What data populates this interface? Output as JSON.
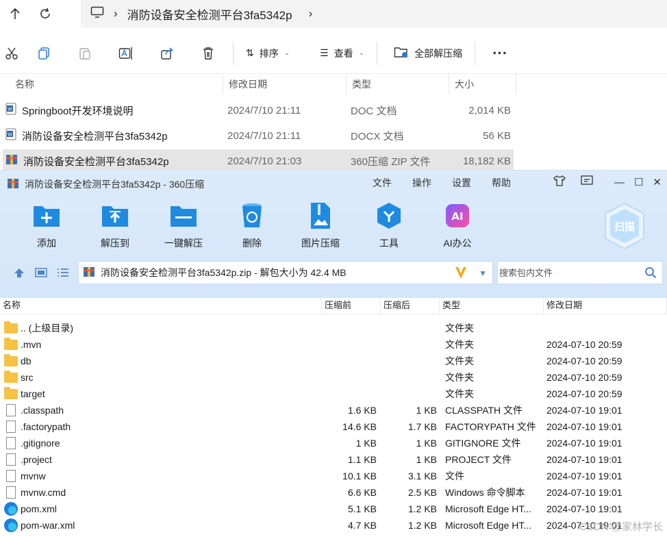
{
  "explorer": {
    "breadcrumb": "消防设备安全检测平台3fa5342p",
    "toolbar": {
      "sort_label": "排序",
      "view_label": "查看",
      "extract_all_label": "全部解压缩"
    },
    "columns": [
      "名称",
      "修改日期",
      "类型",
      "大小"
    ],
    "files": [
      {
        "name": "Springboot开发环境说明",
        "date": "2024/7/10 21:11",
        "type": "DOC 文档",
        "size": "2,014 KB"
      },
      {
        "name": "消防设备安全检测平台3fa5342p",
        "date": "2024/7/10 21:11",
        "type": "DOCX 文档",
        "size": "56 KB"
      },
      {
        "name": "消防设备安全检测平台3fa5342p",
        "date": "2024/7/10 21:03",
        "type": "360压缩 ZIP 文件",
        "size": "18,182 KB"
      }
    ]
  },
  "zip": {
    "title": "消防设备安全检测平台3fa5342p - 360压缩",
    "menu": [
      "文件",
      "操作",
      "设置",
      "帮助"
    ],
    "tools": [
      "添加",
      "解压到",
      "一键解压",
      "删除",
      "图片压缩",
      "工具",
      "AI办公"
    ],
    "scan_label": "扫描",
    "path": "消防设备安全检测平台3fa5342p.zip - 解包大小为 42.4 MB",
    "search_placeholder": "搜索包内文件",
    "columns": [
      "名称",
      "压缩前",
      "压缩后",
      "类型",
      "修改日期"
    ],
    "rows": [
      {
        "name": ".. (上级目录)",
        "before": "",
        "after": "",
        "type": "文件夹",
        "date": "",
        "icon": "folder"
      },
      {
        "name": ".mvn",
        "before": "",
        "after": "",
        "type": "文件夹",
        "date": "2024-07-10 20:59",
        "icon": "folder"
      },
      {
        "name": "db",
        "before": "",
        "after": "",
        "type": "文件夹",
        "date": "2024-07-10 20:59",
        "icon": "folder"
      },
      {
        "name": "src",
        "before": "",
        "after": "",
        "type": "文件夹",
        "date": "2024-07-10 20:59",
        "icon": "folder"
      },
      {
        "name": "target",
        "before": "",
        "after": "",
        "type": "文件夹",
        "date": "2024-07-10 20:59",
        "icon": "folder"
      },
      {
        "name": ".classpath",
        "before": "1.6 KB",
        "after": "1 KB",
        "type": "CLASSPATH 文件",
        "date": "2024-07-10 19:01",
        "icon": "doc"
      },
      {
        "name": ".factorypath",
        "before": "14.6 KB",
        "after": "1.7 KB",
        "type": "FACTORYPATH 文件",
        "date": "2024-07-10 19:01",
        "icon": "doc"
      },
      {
        "name": ".gitignore",
        "before": "1 KB",
        "after": "1 KB",
        "type": "GITIGNORE 文件",
        "date": "2024-07-10 19:01",
        "icon": "doc"
      },
      {
        "name": ".project",
        "before": "1.1 KB",
        "after": "1 KB",
        "type": "PROJECT 文件",
        "date": "2024-07-10 19:01",
        "icon": "doc"
      },
      {
        "name": "mvnw",
        "before": "10.1 KB",
        "after": "3.1 KB",
        "type": "文件",
        "date": "2024-07-10 19:01",
        "icon": "doc"
      },
      {
        "name": "mvnw.cmd",
        "before": "6.6 KB",
        "after": "2.5 KB",
        "type": "Windows 命令脚本",
        "date": "2024-07-10 19:01",
        "icon": "doc"
      },
      {
        "name": "pom.xml",
        "before": "5.1 KB",
        "after": "1.2 KB",
        "type": "Microsoft Edge HT...",
        "date": "2024-07-10 19:01",
        "icon": "edge"
      },
      {
        "name": "pom-war.xml",
        "before": "4.7 KB",
        "after": "1.2 KB",
        "type": "Microsoft Edge HT...",
        "date": "2024-07-10 19:01",
        "icon": "edge"
      }
    ]
  },
  "watermark": "CSDN @家林学长"
}
